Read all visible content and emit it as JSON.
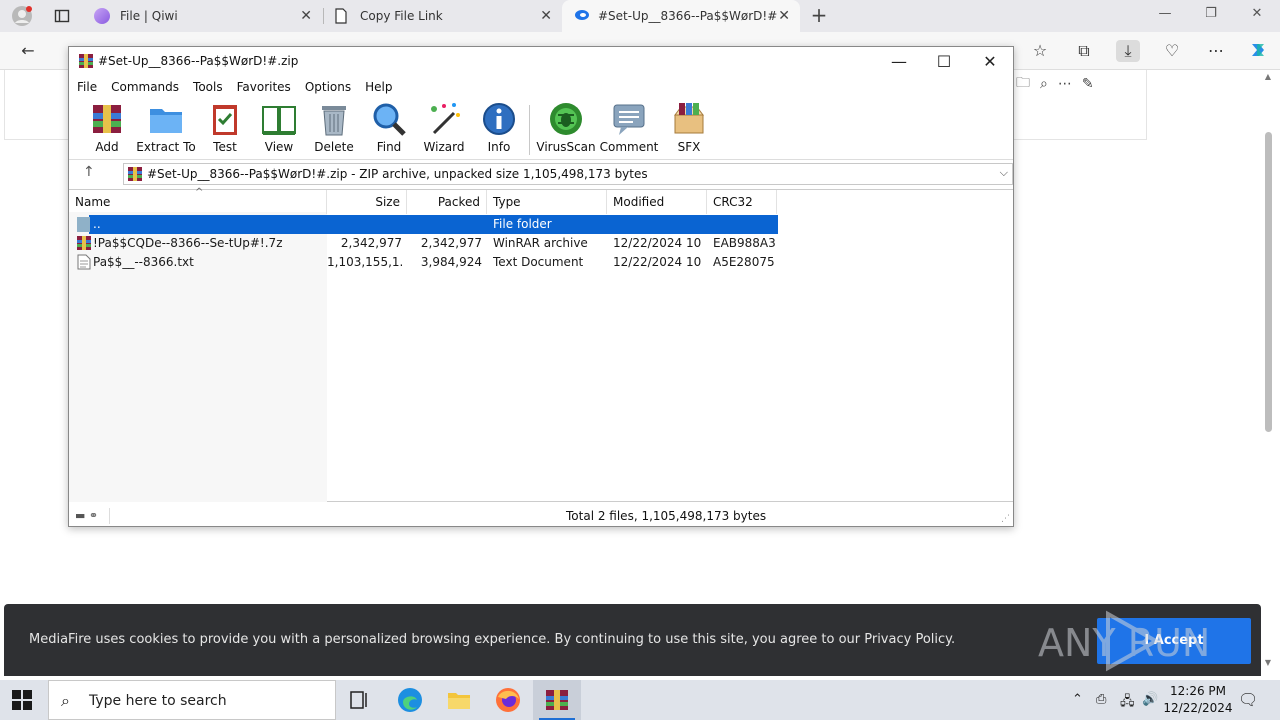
{
  "browser": {
    "tabs": [
      {
        "label": "File | Qiwi"
      },
      {
        "label": "Copy File Link"
      },
      {
        "label": "#Set-Up__8366--Pa$$WørD!#"
      }
    ]
  },
  "winrar": {
    "title": "#Set-Up__8366--Pa$$WørD!#.zip",
    "menu": [
      "File",
      "Commands",
      "Tools",
      "Favorites",
      "Options",
      "Help"
    ],
    "toolbar": [
      "Add",
      "Extract To",
      "Test",
      "View",
      "Delete",
      "Find",
      "Wizard",
      "Info",
      "VirusScan",
      "Comment",
      "SFX"
    ],
    "address": "#Set-Up__8366--Pa$$WørD!#.zip - ZIP archive, unpacked size 1,105,498,173 bytes",
    "columns": [
      "Name",
      "Size",
      "Packed",
      "Type",
      "Modified",
      "CRC32"
    ],
    "rows": [
      {
        "name": "..",
        "size": "",
        "packed": "",
        "type": "File folder",
        "modified": "",
        "crc": ""
      },
      {
        "name": "!Pa$$CQDe--8366--Se-tUp#!.7z",
        "size": "2,342,977",
        "packed": "2,342,977",
        "type": "WinRAR archive",
        "modified": "12/22/2024 10:...",
        "crc": "EAB988A3"
      },
      {
        "name": "Pa$$__--8366.txt",
        "size": "1,103,155,1...",
        "packed": "3,984,924",
        "type": "Text Document",
        "modified": "12/22/2024 10:...",
        "crc": "A5E28075"
      }
    ],
    "status": "Total 2 files, 1,105,498,173 bytes"
  },
  "cookie": {
    "message": "MediaFire uses cookies to provide you with a personalized browsing experience. By continuing to use this site, you agree to our Privacy Policy.",
    "accept": "I Accept"
  },
  "watermark": "ANY RUN",
  "taskbar": {
    "search_placeholder": "Type here to search",
    "time": "12:26 PM",
    "date": "12/22/2024"
  },
  "colors": {
    "selection": "#0a64d2",
    "accept_button": "#1f74e8",
    "cookie_bg": "#2f3033",
    "taskbar_bg": "#dfe3ea"
  }
}
